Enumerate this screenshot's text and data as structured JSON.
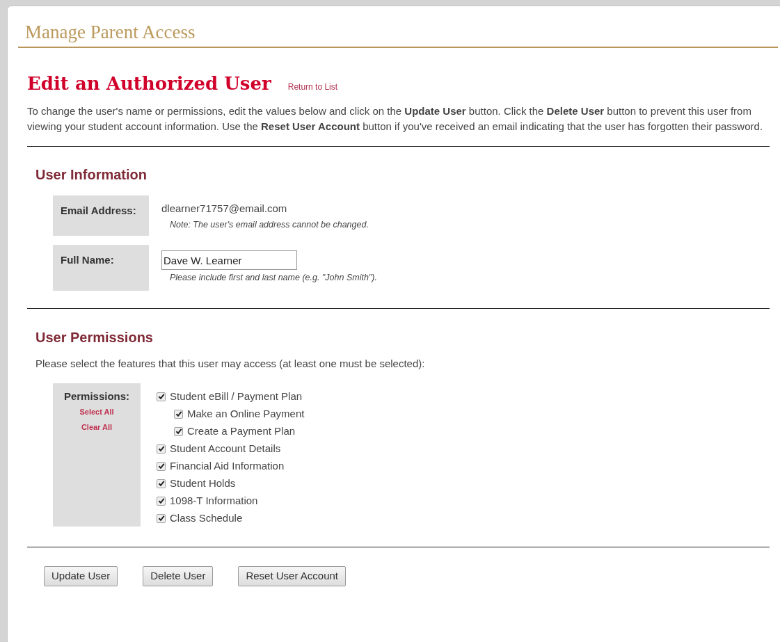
{
  "page_title": "Manage Parent Access",
  "heading": "Edit an Authorized User",
  "return_link": "Return to List",
  "intro": "To change the user's name or permissions, edit the values below and click on the **Update User** button. Click the **Delete User** button to prevent this user from viewing your student account information. Use the **Reset User Account** button if you've received an email indicating that the user has forgotten their password.",
  "user_information": {
    "title": "User Information",
    "email": {
      "label": "Email Address:",
      "value": "dlearner71757@email.com",
      "note": "Note: The user's email address cannot be changed."
    },
    "full_name": {
      "label": "Full Name:",
      "value": "Dave W. Learner",
      "note": "Please include first and last name (e.g. \"John Smith\")."
    }
  },
  "user_permissions": {
    "title": "User Permissions",
    "instruction": "Please select the features that this user may access (at least one must be selected):",
    "label": "Permissions:",
    "select_all": "Select All",
    "clear_all": "Clear All",
    "items": [
      {
        "label": "Student eBill / Payment Plan",
        "checked": true,
        "children": [
          {
            "label": "Make an Online Payment",
            "checked": true
          },
          {
            "label": "Create a Payment Plan",
            "checked": true
          }
        ]
      },
      {
        "label": "Student Account Details",
        "checked": true
      },
      {
        "label": "Financial Aid Information",
        "checked": true
      },
      {
        "label": "Student Holds",
        "checked": true
      },
      {
        "label": "1098-T Information",
        "checked": true
      },
      {
        "label": "Class Schedule",
        "checked": true
      }
    ]
  },
  "buttons": [
    "Update User",
    "Delete User",
    "Reset User Account"
  ]
}
